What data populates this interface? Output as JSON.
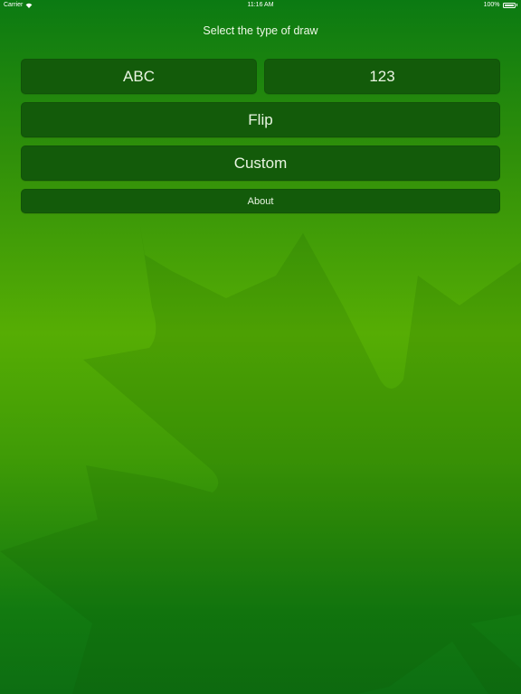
{
  "status_bar": {
    "carrier": "Carrier",
    "wifi_icon": "wifi-icon",
    "time": "11:16 AM",
    "battery_percent": "100%",
    "battery_icon": "battery-icon",
    "battery_level": 1.0
  },
  "prompt": "Select the type of draw",
  "buttons": {
    "abc": "ABC",
    "numbers": "123",
    "flip": "Flip",
    "custom": "Custom",
    "about": "About"
  },
  "colors": {
    "button_background": "#135b0a",
    "button_text": "#e9f5e2",
    "background_top": "#0b7a12",
    "background_mid": "#56ad04",
    "background_bottom": "#0d6e12"
  },
  "background_image": "maple-leaf-watermark"
}
